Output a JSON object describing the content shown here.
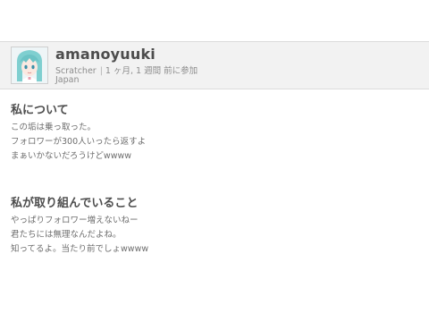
{
  "profile": {
    "username": "amanoyuuki",
    "role": "Scratcher",
    "joined": "1 ヶ月, 1 週間 前に参加",
    "location": "Japan"
  },
  "about": {
    "title": "私について",
    "lines": [
      "この垢は乗っ取った。",
      "フォロワーが300人いったら返すよ",
      "まぁいかないだろうけどwwww"
    ]
  },
  "working_on": {
    "title": "私が取り組んでいること",
    "lines": [
      "やっぱりフォロワー増えないねー",
      "君たちには無理なんだよね。",
      "知ってるよ。当たり前でしょwwww"
    ]
  },
  "colors": {
    "header_bg": "#f2f2f2",
    "text_dark": "#4d4d4d",
    "text_muted": "#8c8c8c"
  }
}
